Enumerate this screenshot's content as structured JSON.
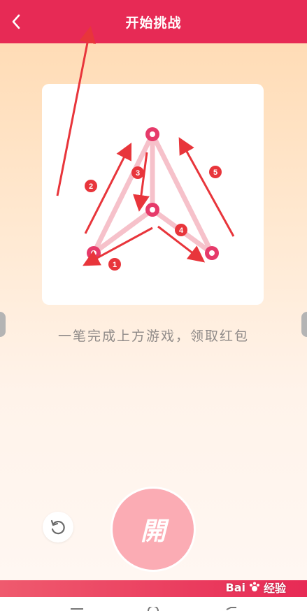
{
  "header": {
    "title": "开始挑战"
  },
  "game": {
    "instruction": "一笔完成上方游戏，领取红包",
    "step_labels": [
      "1",
      "2",
      "3",
      "4",
      "5"
    ]
  },
  "actions": {
    "open_label": "開"
  },
  "watermark": {
    "brand_text": "Bai",
    "brand_suffix": "经验"
  },
  "colors": {
    "accent": "#e72a55",
    "arrow": "#e8353b",
    "node": "#e63a6a",
    "open_button": "#fbacb4"
  }
}
